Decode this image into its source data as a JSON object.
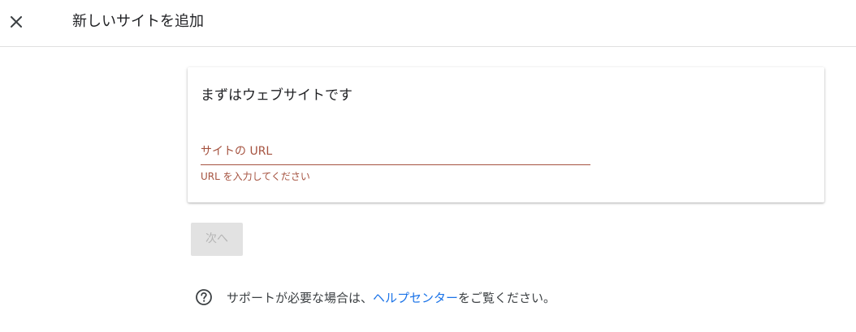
{
  "header": {
    "title": "新しいサイトを追加",
    "close_icon": "close-icon"
  },
  "card": {
    "title": "まずはウェブサイトです",
    "url_field": {
      "label": "サイトの URL",
      "value": "",
      "error": "URL を入力してください"
    }
  },
  "actions": {
    "next_label": "次へ"
  },
  "help": {
    "icon": "help-circle-icon",
    "text_before": "サポートが必要な場合は、",
    "link_label": "ヘルプセンター",
    "text_after": "をご覧ください。"
  },
  "colors": {
    "error": "#a5523f",
    "link": "#1a73e8",
    "button_disabled_bg": "#e2e2e2",
    "button_disabled_text": "#b5b5b5"
  }
}
